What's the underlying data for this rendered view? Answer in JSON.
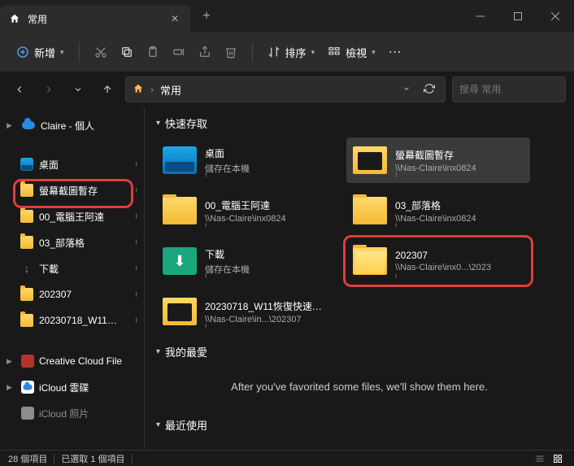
{
  "titlebar": {
    "tab_title": "常用"
  },
  "toolbar": {
    "new_label": "新增",
    "sort_label": "排序",
    "view_label": "檢視"
  },
  "addressbar": {
    "crumb": "常用"
  },
  "searchbox": {
    "placeholder": "搜尋 常用"
  },
  "sidebar": {
    "root": "Claire - 個人",
    "quick": [
      {
        "label": "桌面",
        "icon": "desktop"
      },
      {
        "label": "螢幕截圖暫存",
        "icon": "folder"
      },
      {
        "label": "00_電腦王阿達",
        "icon": "folder"
      },
      {
        "label": "03_部落格",
        "icon": "folder"
      },
      {
        "label": "下載",
        "icon": "download"
      },
      {
        "label": "202307",
        "icon": "folder"
      },
      {
        "label": "20230718_W11…",
        "icon": "folder"
      }
    ],
    "other": [
      {
        "label": "Creative Cloud File",
        "icon": "cc"
      },
      {
        "label": "iCloud 雲碟",
        "icon": "icloud"
      },
      {
        "label": "iCloud 照片",
        "icon": "icloud"
      }
    ]
  },
  "sections": {
    "quick_access": "快速存取",
    "favorites": "我的最愛",
    "recent": "最近使用",
    "favorites_empty": "After you've favorited some files, we'll show them here."
  },
  "items": [
    {
      "name": "桌面",
      "path": "儲存在本機",
      "icon": "desktop"
    },
    {
      "name": "螢幕截圖暫存",
      "path": "\\\\Nas-Claire\\inx0824",
      "icon": "screenshot",
      "selected": true
    },
    {
      "name": "00_電腦王阿達",
      "path": "\\\\Nas-Claire\\inx0824",
      "icon": "folder"
    },
    {
      "name": "03_部落格",
      "path": "\\\\Nas-Claire\\inx0824",
      "icon": "folder"
    },
    {
      "name": "下載",
      "path": "儲存在本機",
      "icon": "download"
    },
    {
      "name": "202307",
      "path": "\\\\Nas-Claire\\inx0...\\2023",
      "icon": "folder-open",
      "highlight": true
    },
    {
      "name": "20230718_W11恢復快速…",
      "path": "\\\\Nas-Claire\\in...\\202307",
      "icon": "screenshot"
    }
  ],
  "statusbar": {
    "count": "28 個項目",
    "selected": "已選取 1 個項目"
  }
}
